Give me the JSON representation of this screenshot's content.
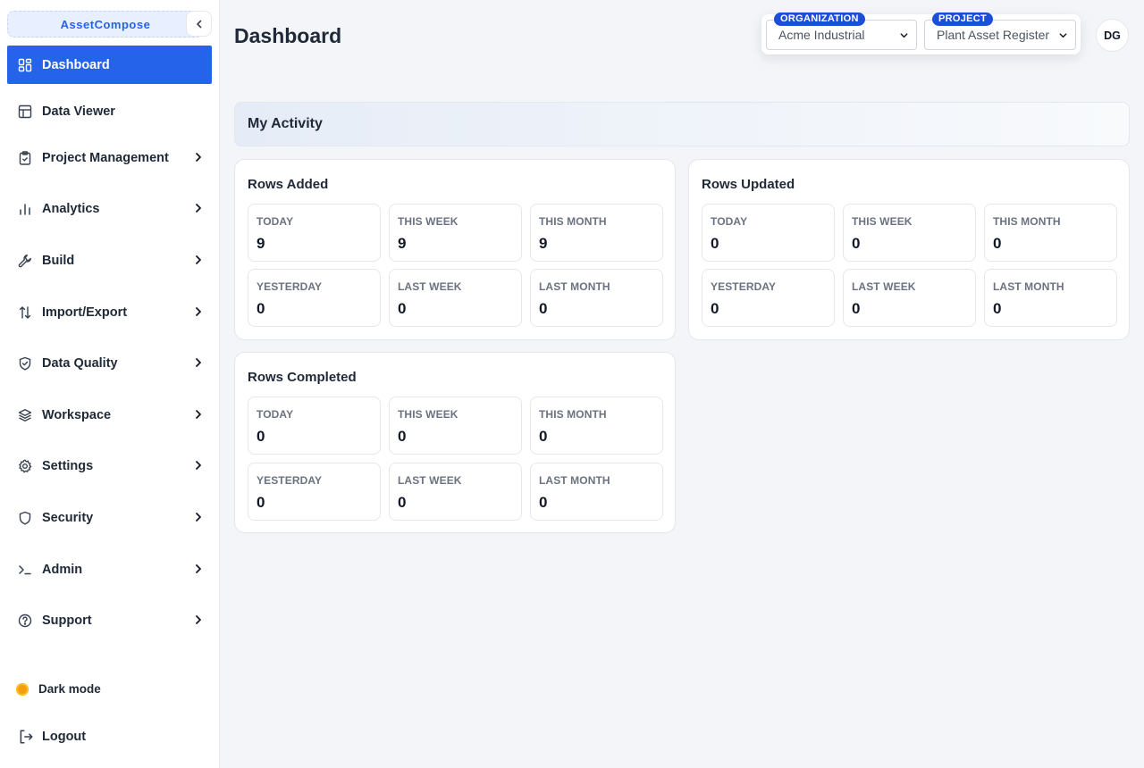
{
  "app": {
    "brand": "AssetCompose"
  },
  "sidebar": {
    "items": [
      {
        "label": "Dashboard",
        "icon": "dashboard-icon",
        "active": true
      },
      {
        "label": "Data Viewer",
        "icon": "table-icon"
      },
      {
        "label": "Project Management",
        "icon": "clipboard-icon"
      },
      {
        "label": "Analytics",
        "icon": "bar-chart-icon"
      },
      {
        "label": "Build",
        "icon": "wrench-icon"
      },
      {
        "label": "Import/Export",
        "icon": "arrows-updown-icon"
      },
      {
        "label": "Data Quality",
        "icon": "shield-check-icon"
      },
      {
        "label": "Workspace",
        "icon": "layers-icon"
      },
      {
        "label": "Settings",
        "icon": "gear-icon"
      },
      {
        "label": "Security",
        "icon": "shield-icon"
      },
      {
        "label": "Admin",
        "icon": "terminal-icon"
      },
      {
        "label": "Support",
        "icon": "help-circle-icon"
      }
    ],
    "dark_mode_label": "Dark mode",
    "logout_label": "Logout"
  },
  "header": {
    "title": "Dashboard",
    "organization": {
      "badge": "ORGANIZATION",
      "value": "Acme Industrial"
    },
    "project": {
      "badge": "PROJECT",
      "value": "Plant Asset Register"
    },
    "avatar_initials": "DG"
  },
  "activity": {
    "title": "My Activity",
    "cards": [
      {
        "title": "Rows Added",
        "stats": [
          {
            "label": "TODAY",
            "value": "9"
          },
          {
            "label": "THIS WEEK",
            "value": "9"
          },
          {
            "label": "THIS MONTH",
            "value": "9"
          },
          {
            "label": "YESTERDAY",
            "value": "0"
          },
          {
            "label": "LAST WEEK",
            "value": "0"
          },
          {
            "label": "LAST MONTH",
            "value": "0"
          }
        ]
      },
      {
        "title": "Rows Updated",
        "stats": [
          {
            "label": "TODAY",
            "value": "0"
          },
          {
            "label": "THIS WEEK",
            "value": "0"
          },
          {
            "label": "THIS MONTH",
            "value": "0"
          },
          {
            "label": "YESTERDAY",
            "value": "0"
          },
          {
            "label": "LAST WEEK",
            "value": "0"
          },
          {
            "label": "LAST MONTH",
            "value": "0"
          }
        ]
      },
      {
        "title": "Rows Completed",
        "stats": [
          {
            "label": "TODAY",
            "value": "0"
          },
          {
            "label": "THIS WEEK",
            "value": "0"
          },
          {
            "label": "THIS MONTH",
            "value": "0"
          },
          {
            "label": "YESTERDAY",
            "value": "0"
          },
          {
            "label": "LAST WEEK",
            "value": "0"
          },
          {
            "label": "LAST MONTH",
            "value": "0"
          }
        ]
      }
    ]
  },
  "colors": {
    "accent": "#2563eb",
    "badge": "#1d4ed8",
    "dark_mode_dot": "#f59e0b"
  }
}
